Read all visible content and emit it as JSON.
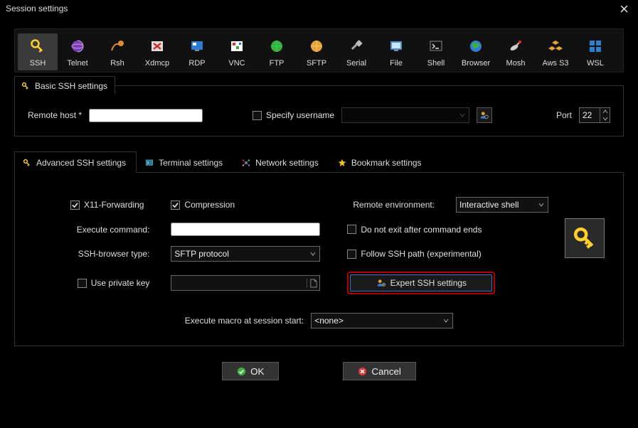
{
  "window": {
    "title": "Session settings"
  },
  "session_types": [
    {
      "id": "ssh",
      "label": "SSH",
      "selected": true
    },
    {
      "id": "telnet",
      "label": "Telnet",
      "selected": false
    },
    {
      "id": "rsh",
      "label": "Rsh",
      "selected": false
    },
    {
      "id": "xdmcp",
      "label": "Xdmcp",
      "selected": false
    },
    {
      "id": "rdp",
      "label": "RDP",
      "selected": false
    },
    {
      "id": "vnc",
      "label": "VNC",
      "selected": false
    },
    {
      "id": "ftp",
      "label": "FTP",
      "selected": false
    },
    {
      "id": "sftp",
      "label": "SFTP",
      "selected": false
    },
    {
      "id": "serial",
      "label": "Serial",
      "selected": false
    },
    {
      "id": "file",
      "label": "File",
      "selected": false
    },
    {
      "id": "shell",
      "label": "Shell",
      "selected": false
    },
    {
      "id": "browser",
      "label": "Browser",
      "selected": false
    },
    {
      "id": "mosh",
      "label": "Mosh",
      "selected": false
    },
    {
      "id": "awss3",
      "label": "Aws S3",
      "selected": false
    },
    {
      "id": "wsl",
      "label": "WSL",
      "selected": false
    }
  ],
  "basic": {
    "tab_label": "Basic SSH settings",
    "remote_host_label": "Remote host *",
    "remote_host_value": "",
    "specify_username_label": "Specify username",
    "specify_username_checked": false,
    "username_value": "",
    "port_label": "Port",
    "port_value": "22"
  },
  "adv_tabs": {
    "advanced": "Advanced SSH settings",
    "terminal": "Terminal settings",
    "network": "Network settings",
    "bookmark": "Bookmark settings"
  },
  "advanced": {
    "x11_label": "X11-Forwarding",
    "x11_checked": true,
    "compression_label": "Compression",
    "compression_checked": true,
    "remote_env_label": "Remote environment:",
    "remote_env_value": "Interactive shell",
    "exec_cmd_label": "Execute command:",
    "exec_cmd_value": "",
    "no_exit_label": "Do not exit after command ends",
    "no_exit_checked": false,
    "ssh_browser_label": "SSH-browser type:",
    "ssh_browser_value": "SFTP protocol",
    "follow_path_label": "Follow SSH path (experimental)",
    "follow_path_checked": false,
    "use_pk_label": "Use private key",
    "use_pk_checked": false,
    "pk_value": "",
    "expert_label": "Expert SSH settings",
    "macro_label": "Execute macro at session start:",
    "macro_value": "<none>"
  },
  "buttons": {
    "ok": "OK",
    "cancel": "Cancel"
  }
}
